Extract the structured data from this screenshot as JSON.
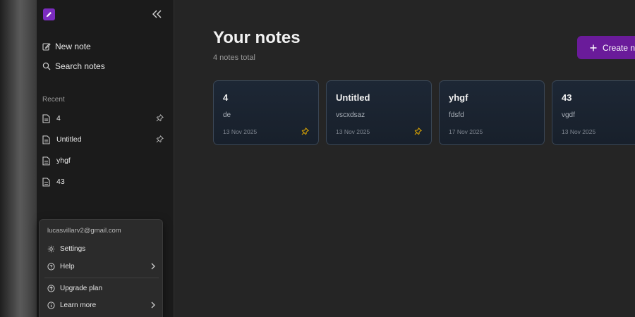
{
  "sidebar": {
    "new_note": "New note",
    "search_notes": "Search notes",
    "recent_label": "Recent",
    "recent": [
      {
        "label": "4",
        "pinned": true
      },
      {
        "label": "Untitled",
        "pinned": true
      },
      {
        "label": "yhgf",
        "pinned": false
      },
      {
        "label": "43",
        "pinned": false
      }
    ]
  },
  "menu": {
    "email": "lucasvillarv2@gmail.com",
    "settings": "Settings",
    "help": "Help",
    "upgrade": "Upgrade plan",
    "learn_more": "Learn more"
  },
  "main": {
    "title": "Your notes",
    "subtitle": "4 notes total",
    "create_label": "Create no",
    "notes": [
      {
        "title": "4",
        "preview": "de",
        "date": "13 Nov 2025",
        "pinned": true
      },
      {
        "title": "Untitled",
        "preview": "vscxdsaz",
        "date": "13 Nov 2025",
        "pinned": true
      },
      {
        "title": "yhgf",
        "preview": "fdsfd",
        "date": "17 Nov 2025",
        "pinned": false
      },
      {
        "title": "43",
        "preview": "vgdf",
        "date": "13 Nov 2025",
        "pinned": false
      }
    ]
  },
  "colors": {
    "accent": "#6a1b9a",
    "logo": "#7b2cbf",
    "pin": "#e0a800",
    "sidebar_bg": "#1b1b1b",
    "main_bg": "#252525",
    "card_border": "#3a4655"
  },
  "icons": [
    "logo-pencil-icon",
    "collapse-double-chevron-icon",
    "edit-icon",
    "search-icon",
    "document-icon",
    "pin-icon",
    "gear-icon",
    "help-circle-icon",
    "chevron-right-icon",
    "upgrade-arrow-icon",
    "info-icon",
    "plus-icon"
  ]
}
